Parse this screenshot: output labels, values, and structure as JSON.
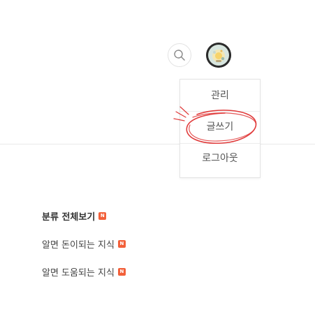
{
  "header": {
    "search_icon": "search-icon",
    "avatar_icon": "profile-avatar"
  },
  "dropdown": {
    "items": [
      {
        "label": "관리"
      },
      {
        "label": "글쓰기"
      },
      {
        "label": "로그아웃"
      }
    ],
    "highlight_color": "#e03b3b"
  },
  "categories": {
    "all_label": "분류 전체보기",
    "items": [
      {
        "label": "알면 돈이되는 지식"
      },
      {
        "label": "알면 도움되는 지식"
      }
    ],
    "new_badge_text": "N",
    "new_badge_color": "#f2603a"
  }
}
